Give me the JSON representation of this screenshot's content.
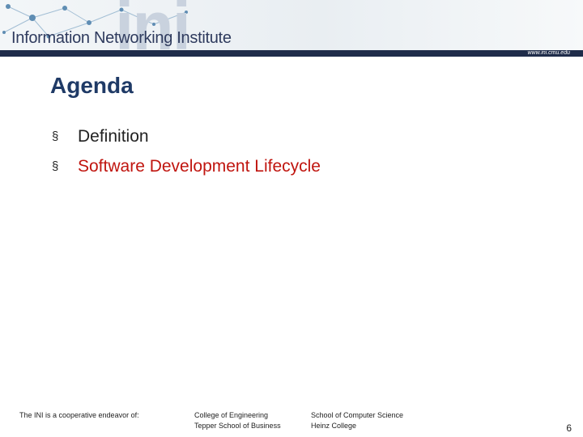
{
  "banner": {
    "institute_name": "Information Networking Institute",
    "watermark": "ini",
    "website": "www.ini.cmu.edu"
  },
  "slide": {
    "title": "Agenda",
    "bullet_glyph": "§",
    "items": [
      "Definition",
      "Software Development Lifecycle"
    ],
    "colors": {
      "title": "#1f3a66",
      "highlight": "#c0150f",
      "text": "#222222"
    }
  },
  "footer": {
    "cooperative": "The INI is a cooperative endeavor of:",
    "col1": [
      "College of Engineering",
      "Tepper School of Business"
    ],
    "col2": [
      "School of Computer Science",
      "Heinz College"
    ],
    "page_number": "6"
  }
}
